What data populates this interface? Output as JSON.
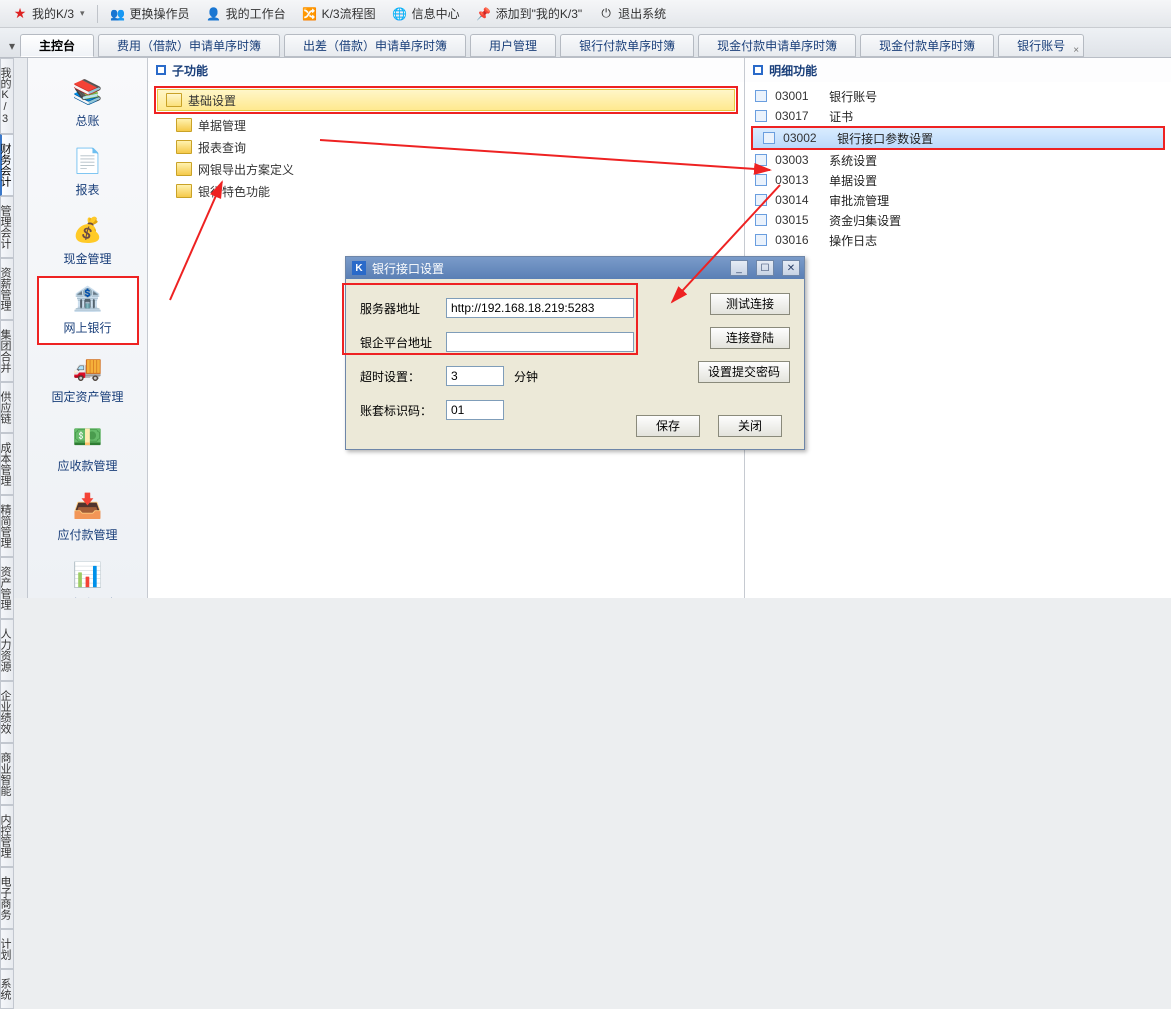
{
  "toolbar": {
    "myk3": "我的K/3",
    "change_op": "更换操作员",
    "workbench": "我的工作台",
    "flowchart": "K/3流程图",
    "info_center": "信息中心",
    "add_to_myk3": "添加到\"我的K/3\"",
    "exit": "退出系统"
  },
  "tabs": [
    {
      "label": "主控台",
      "active": true
    },
    {
      "label": "费用（借款）申请单序时簿"
    },
    {
      "label": "出差（借款）申请单序时簿"
    },
    {
      "label": "用户管理"
    },
    {
      "label": "银行付款单序时簿"
    },
    {
      "label": "现金付款申请单序时簿"
    },
    {
      "label": "现金付款单序时簿"
    },
    {
      "label": "银行账号",
      "closable": true
    }
  ],
  "vtabs_left": [
    "我的K/3",
    "财务会计",
    "管理会计",
    "资薪管理",
    "集团合并",
    "供应链",
    "成本管理"
  ],
  "vtabs_right": [
    "精简管理",
    "资产管理",
    "人力资源",
    "企业绩效",
    "商业智能",
    "内控管理",
    "电子商务",
    "计划",
    "系统"
  ],
  "modules": [
    {
      "label": "总账",
      "icon": "📚"
    },
    {
      "label": "报表",
      "icon": "📄"
    },
    {
      "label": "现金管理",
      "icon": "💰"
    },
    {
      "label": "网上银行",
      "icon": "🏦",
      "selected": true
    },
    {
      "label": "固定资产管理",
      "icon": "🚚"
    },
    {
      "label": "应收款管理",
      "icon": "💵"
    },
    {
      "label": "应付款管理",
      "icon": "📥"
    },
    {
      "label": "现金流量表",
      "icon": "📊"
    }
  ],
  "left_panel": {
    "title": "子功能"
  },
  "tree": [
    {
      "label": "基础设置",
      "selected": true,
      "hi": true,
      "open": true
    },
    {
      "label": "单据管理"
    },
    {
      "label": "报表查询"
    },
    {
      "label": "网银导出方案定义"
    },
    {
      "label": "银行特色功能"
    }
  ],
  "right_panel": {
    "title": "明细功能"
  },
  "details": [
    {
      "code": "03001",
      "label": "银行账号"
    },
    {
      "code": "03017",
      "label": "证书"
    },
    {
      "code": "03002",
      "label": "银行接口参数设置",
      "selected": true,
      "hi": true
    },
    {
      "code": "03003",
      "label": "系统设置"
    },
    {
      "code": "03013",
      "label": "单据设置"
    },
    {
      "code": "03014",
      "label": "审批流管理"
    },
    {
      "code": "03015",
      "label": "资金归集设置"
    },
    {
      "code": "03016",
      "label": "操作日志"
    }
  ],
  "dialog": {
    "title": "银行接口设置",
    "server_label": "服务器地址",
    "server_value": "http://192.168.18.219:5283",
    "platform_label": "银企平台地址",
    "platform_value": "",
    "timeout_label": "超时设置：",
    "timeout_value": "3",
    "timeout_unit": "分钟",
    "acct_label": "账套标识码：",
    "acct_value": "01",
    "btn_test": "测试连接",
    "btn_login": "连接登陆",
    "btn_pwd": "设置提交密码",
    "btn_save": "保存",
    "btn_close": "关闭"
  }
}
